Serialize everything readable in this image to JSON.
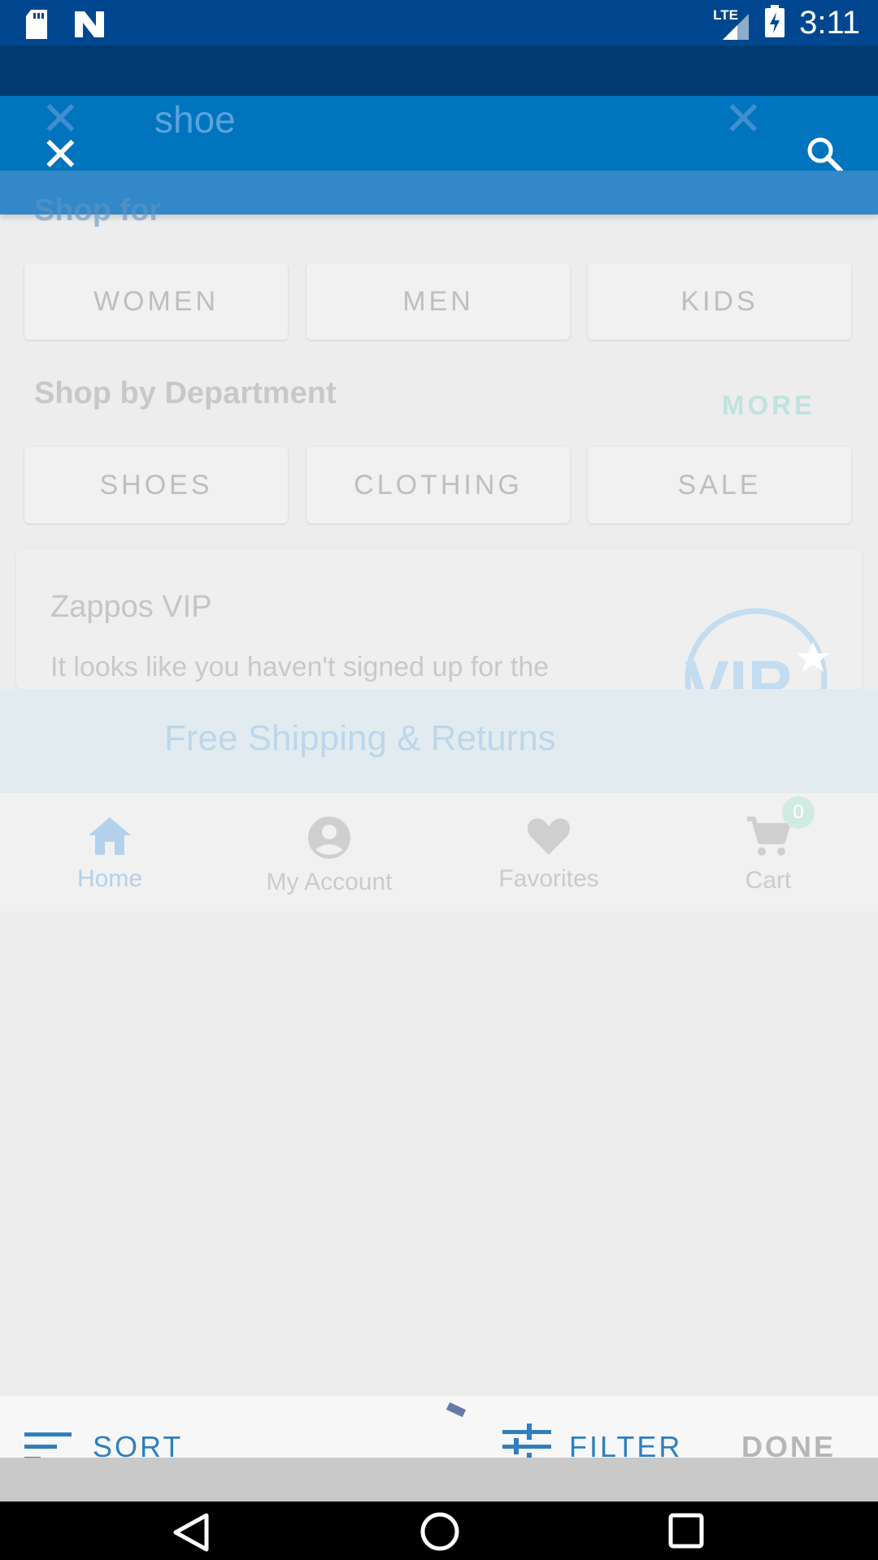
{
  "status_bar": {
    "time": "3:11",
    "network": "LTE",
    "icons": [
      "sd-card-icon",
      "n-logo-icon",
      "signal-icon",
      "battery-charging-icon"
    ]
  },
  "search": {
    "query": "shoe",
    "close_icon": "close-icon",
    "clear_icon": "close-icon",
    "search_icon": "search-icon"
  },
  "shop_for": {
    "title": "Shop for",
    "items": [
      "WOMEN",
      "MEN",
      "KIDS"
    ]
  },
  "department": {
    "title": "Shop by Department",
    "more": "MORE",
    "items": [
      "SHOES",
      "CLOTHING",
      "SALE"
    ]
  },
  "vip": {
    "title": "Zappos VIP",
    "description": "It looks like you haven't signed up for the",
    "logo_text": "VIP"
  },
  "banner": {
    "text": "Free Shipping & Returns"
  },
  "bottom_nav": {
    "items": [
      {
        "label": "Home",
        "icon": "home-icon"
      },
      {
        "label": "My Account",
        "icon": "account-icon"
      },
      {
        "label": "Favorites",
        "icon": "heart-icon"
      },
      {
        "label": "Cart",
        "icon": "cart-icon"
      }
    ],
    "cart_count": "0"
  },
  "results_toolbar": {
    "sort": "SORT",
    "filter": "FILTER",
    "done": "DONE"
  },
  "colors": {
    "status_bar": "#00478f",
    "app_bar": "#0074bd",
    "accent": "#2f7fbf"
  }
}
